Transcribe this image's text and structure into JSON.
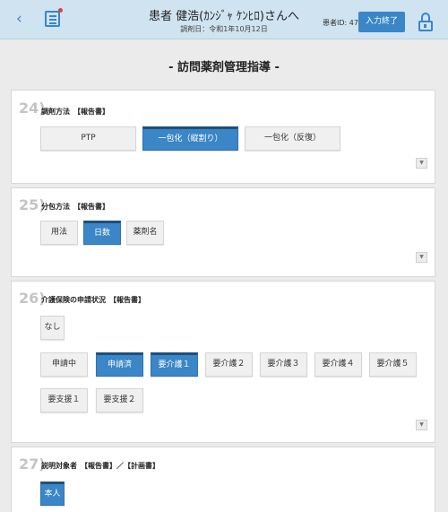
{
  "header": {
    "back_icon": "‹",
    "title": "患者 健浩(ｶﾝｼﾞｬ ｹﾝﾋﾛ)さんへ",
    "subtitle": "調剤日：令和1年10月12日",
    "patient_id": "患者ID: 47",
    "finish_label": "入力終了"
  },
  "page_title": "- 訪問薬剤管理指導 -",
  "sections": [
    {
      "number": "24)",
      "label": "調剤方法　【報告書】",
      "options": [
        "PTP",
        "一包化（縦割り）",
        "一包化（反復）"
      ],
      "selected": "一包化（縦割り）"
    },
    {
      "number": "25)",
      "label": "分包方法　【報告書】",
      "options": [
        "用法",
        "日数",
        "薬剤名"
      ],
      "selected": "日数"
    },
    {
      "number": "26)",
      "label": "介護保険の申請状況　【報告書】",
      "options": [
        "なし",
        "申請中",
        "申請済",
        "要介護１",
        "要介護２",
        "要介護３",
        "要介護４",
        "要介護５",
        "要支援１",
        "要支援２"
      ],
      "selected": [
        "申請済",
        "要介護１"
      ]
    },
    {
      "number": "27)",
      "label": "説明対象者　【報告書】／【計画書】",
      "options": [
        "本人"
      ],
      "selected": "本人"
    }
  ],
  "collapse_icon": "▼",
  "colors": {
    "accent": "#3a86c6",
    "header_bg": "#cfe3f1",
    "page_bg": "#ebebeb"
  }
}
